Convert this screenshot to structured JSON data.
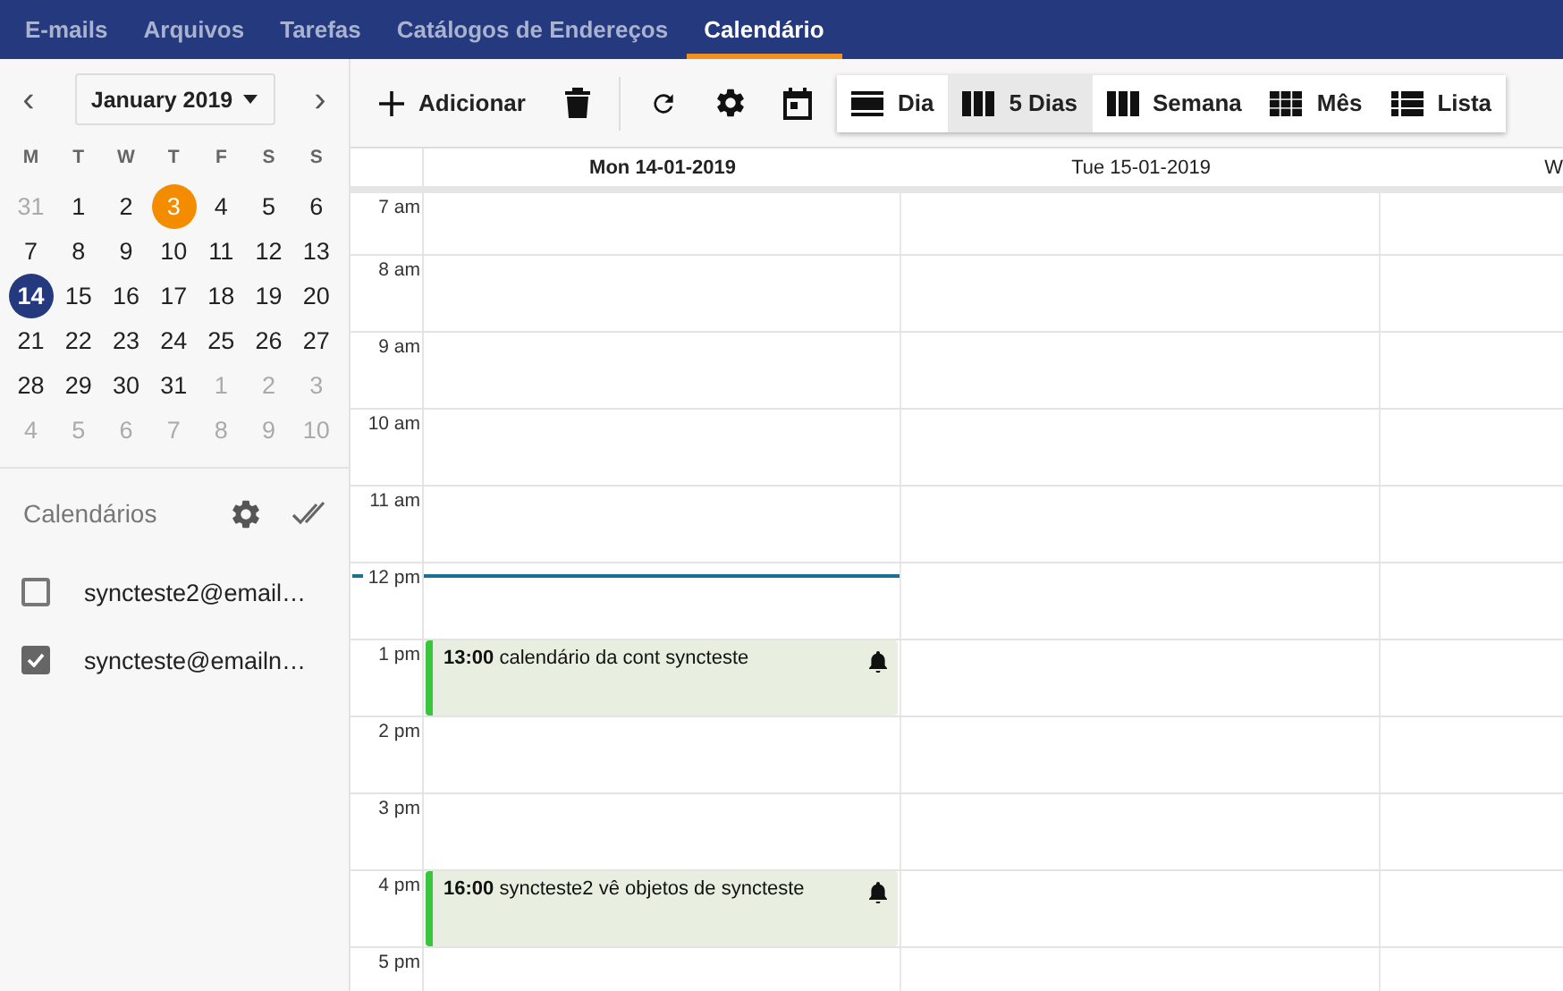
{
  "nav": [
    {
      "label": "E-mails",
      "selected": false
    },
    {
      "label": "Arquivos",
      "selected": false
    },
    {
      "label": "Tarefas",
      "selected": false
    },
    {
      "label": "Catálogos de Endereços",
      "selected": false
    },
    {
      "label": "Calendário",
      "selected": true
    }
  ],
  "mini_calendar": {
    "prev": "‹",
    "next": "›",
    "month": "January 2019",
    "weekdays": [
      "M",
      "T",
      "W",
      "T",
      "F",
      "S",
      "S"
    ],
    "weeks": [
      [
        {
          "n": "31",
          "muted": true,
          "today": false,
          "selected": false
        },
        {
          "n": "1",
          "muted": false,
          "today": false,
          "selected": false
        },
        {
          "n": "2",
          "muted": false,
          "today": false,
          "selected": false
        },
        {
          "n": "3",
          "muted": false,
          "today": true,
          "selected": false
        },
        {
          "n": "4",
          "muted": false,
          "today": false,
          "selected": false
        },
        {
          "n": "5",
          "muted": false,
          "today": false,
          "selected": false
        },
        {
          "n": "6",
          "muted": false,
          "today": false,
          "selected": false
        }
      ],
      [
        {
          "n": "7",
          "muted": false,
          "today": false,
          "selected": false
        },
        {
          "n": "8",
          "muted": false,
          "today": false,
          "selected": false
        },
        {
          "n": "9",
          "muted": false,
          "today": false,
          "selected": false
        },
        {
          "n": "10",
          "muted": false,
          "today": false,
          "selected": false
        },
        {
          "n": "11",
          "muted": false,
          "today": false,
          "selected": false
        },
        {
          "n": "12",
          "muted": false,
          "today": false,
          "selected": false
        },
        {
          "n": "13",
          "muted": false,
          "today": false,
          "selected": false
        }
      ],
      [
        {
          "n": "14",
          "muted": false,
          "today": false,
          "selected": true
        },
        {
          "n": "15",
          "muted": false,
          "today": false,
          "selected": false
        },
        {
          "n": "16",
          "muted": false,
          "today": false,
          "selected": false
        },
        {
          "n": "17",
          "muted": false,
          "today": false,
          "selected": false
        },
        {
          "n": "18",
          "muted": false,
          "today": false,
          "selected": false
        },
        {
          "n": "19",
          "muted": false,
          "today": false,
          "selected": false
        },
        {
          "n": "20",
          "muted": false,
          "today": false,
          "selected": false
        }
      ],
      [
        {
          "n": "21",
          "muted": false,
          "today": false,
          "selected": false
        },
        {
          "n": "22",
          "muted": false,
          "today": false,
          "selected": false
        },
        {
          "n": "23",
          "muted": false,
          "today": false,
          "selected": false
        },
        {
          "n": "24",
          "muted": false,
          "today": false,
          "selected": false
        },
        {
          "n": "25",
          "muted": false,
          "today": false,
          "selected": false
        },
        {
          "n": "26",
          "muted": false,
          "today": false,
          "selected": false
        },
        {
          "n": "27",
          "muted": false,
          "today": false,
          "selected": false
        }
      ],
      [
        {
          "n": "28",
          "muted": false,
          "today": false,
          "selected": false
        },
        {
          "n": "29",
          "muted": false,
          "today": false,
          "selected": false
        },
        {
          "n": "30",
          "muted": false,
          "today": false,
          "selected": false
        },
        {
          "n": "31",
          "muted": false,
          "today": false,
          "selected": false
        },
        {
          "n": "1",
          "muted": true,
          "today": false,
          "selected": false
        },
        {
          "n": "2",
          "muted": true,
          "today": false,
          "selected": false
        },
        {
          "n": "3",
          "muted": true,
          "today": false,
          "selected": false
        }
      ],
      [
        {
          "n": "4",
          "muted": true,
          "today": false,
          "selected": false
        },
        {
          "n": "5",
          "muted": true,
          "today": false,
          "selected": false
        },
        {
          "n": "6",
          "muted": true,
          "today": false,
          "selected": false
        },
        {
          "n": "7",
          "muted": true,
          "today": false,
          "selected": false
        },
        {
          "n": "8",
          "muted": true,
          "today": false,
          "selected": false
        },
        {
          "n": "9",
          "muted": true,
          "today": false,
          "selected": false
        },
        {
          "n": "10",
          "muted": true,
          "today": false,
          "selected": false
        }
      ]
    ]
  },
  "calendars": {
    "title": "Calendários",
    "items": [
      {
        "label": "syncteste2@email…",
        "checked": false
      },
      {
        "label": "syncteste@emailn…",
        "checked": true
      }
    ]
  },
  "toolbar": {
    "add": "Adicionar",
    "views": [
      {
        "kind": "day",
        "label": "Dia",
        "selected": false
      },
      {
        "kind": "days",
        "label": "5 Dias",
        "selected": true
      },
      {
        "kind": "week",
        "label": "Semana",
        "selected": false
      },
      {
        "kind": "month",
        "label": "Mês",
        "selected": false
      },
      {
        "kind": "list",
        "label": "Lista",
        "selected": false
      }
    ]
  },
  "days": [
    "Mon 14-01-2019",
    "Tue 15-01-2019",
    "W"
  ],
  "hours": [
    {
      "label": "7 am",
      "now": false
    },
    {
      "label": "8 am",
      "now": false
    },
    {
      "label": "9 am",
      "now": false
    },
    {
      "label": "10 am",
      "now": false
    },
    {
      "label": "11 am",
      "now": false
    },
    {
      "label": "12 pm",
      "now": true
    },
    {
      "label": "1 pm",
      "now": false,
      "events": [
        {
          "time": "13:00",
          "title": "calendário da cont syncteste",
          "reminder": true
        }
      ]
    },
    {
      "label": "2 pm",
      "now": false
    },
    {
      "label": "3 pm",
      "now": false
    },
    {
      "label": "4 pm",
      "now": false,
      "events": [
        {
          "time": "16:00",
          "title": "syncteste2 vê objetos de syncteste",
          "reminder": true
        }
      ]
    },
    {
      "label": "5 pm",
      "now": false
    }
  ]
}
